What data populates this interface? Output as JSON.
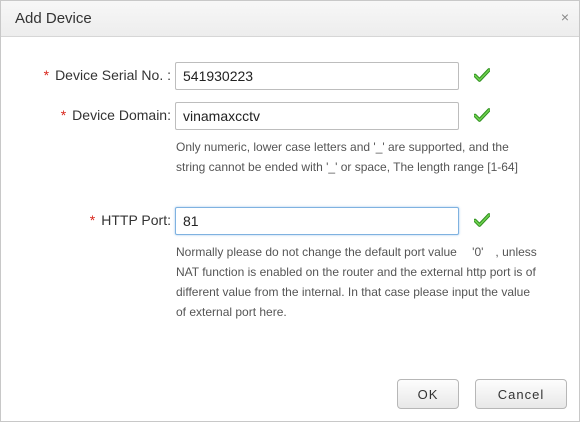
{
  "dialog": {
    "title": "Add Device",
    "close_glyph": "×"
  },
  "form": {
    "required_mark": "*",
    "serial": {
      "label": "Device Serial No. :",
      "value": "541930223",
      "status_icon": "check-icon"
    },
    "domain": {
      "label": "Device Domain:",
      "value": "vinamaxcctv",
      "status_icon": "check-icon",
      "hint": "Only numeric, lower case letters and '_' are supported, and the string cannot be ended with '_' or space, The length range [1-64]"
    },
    "http_port": {
      "label": "HTTP Port:",
      "value": "81",
      "status_icon": "check-icon",
      "hint": "Normally please do not change the default port value 　'0'　, unless NAT function is enabled on the router and the external http port is of different value from the internal. In that case please input the value of external port here."
    }
  },
  "buttons": {
    "ok": "OK",
    "cancel": "Cancel"
  },
  "colors": {
    "required": "#d9261c",
    "check": "#3fae2a",
    "focus_border": "#7fb2e0"
  }
}
